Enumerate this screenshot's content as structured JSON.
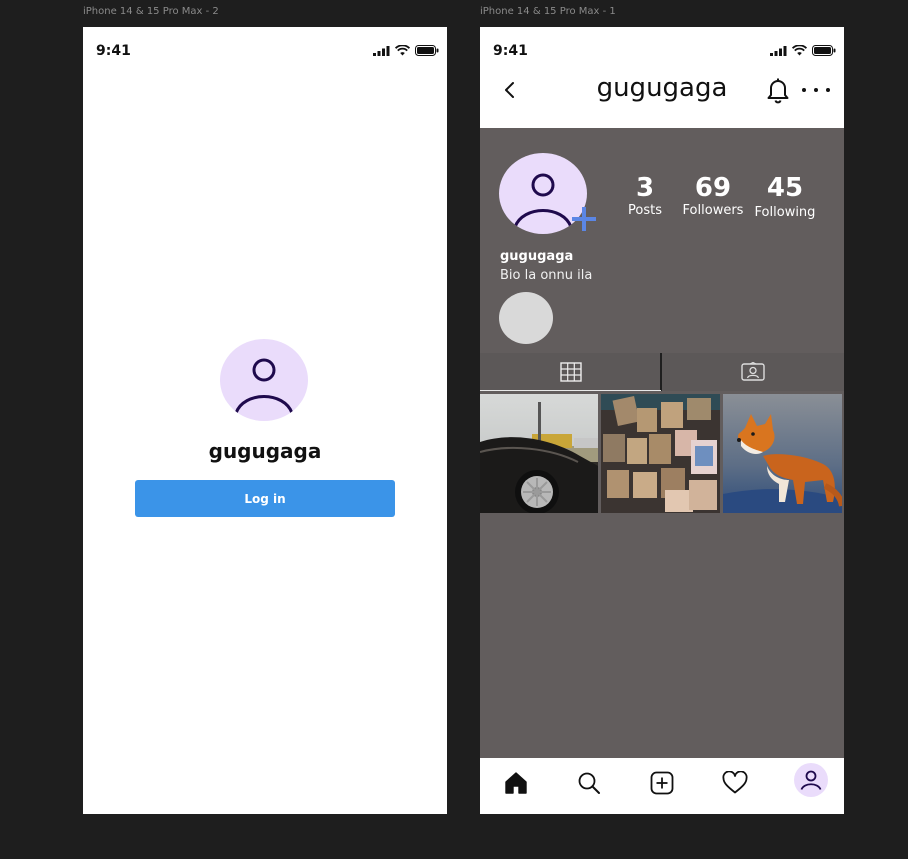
{
  "frames": {
    "left_label": "iPhone 14 & 15 Pro Max - 2",
    "right_label": "iPhone 14 & 15 Pro Max - 1"
  },
  "status_bar": {
    "time": "9:41"
  },
  "login_screen": {
    "username": "gugugaga",
    "login_button": "Log in"
  },
  "profile_screen": {
    "title": "gugugaga",
    "stats": {
      "posts_count": "3",
      "posts_label": "Posts",
      "followers_count": "69",
      "followers_label": "Followers",
      "following_count": "45",
      "following_label": "Following"
    },
    "name": "gugugaga",
    "bio": "Bio la onnu ila",
    "active_tab": "grid",
    "posts": [
      "car-photo",
      "shrine-plaques-photo",
      "fox-photo"
    ]
  },
  "colors": {
    "accent": "#3b94e8",
    "avatar_bg": "#eadcfb",
    "avatar_fg": "#1f0a4d",
    "profile_bg": "#625d5d",
    "plus_blue": "#5b86e5"
  },
  "icons": {
    "status": [
      "signal-icon",
      "wifi-icon",
      "battery-icon"
    ],
    "header": [
      "back-icon",
      "bell-icon",
      "more-icon"
    ],
    "nav": [
      "home-icon",
      "search-icon",
      "add-post-icon",
      "heart-icon",
      "profile-icon"
    ]
  }
}
